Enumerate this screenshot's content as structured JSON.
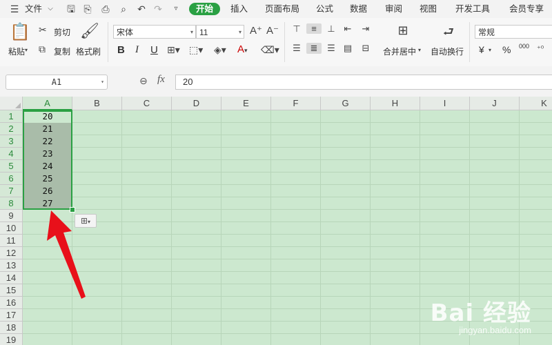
{
  "menubar": {
    "file": "文件",
    "tabs": [
      "开始",
      "插入",
      "页面布局",
      "公式",
      "数据",
      "审阅",
      "视图",
      "开发工具",
      "会员专享"
    ],
    "active_tab": "开始"
  },
  "ribbon": {
    "paste": "粘贴",
    "cut": "剪切",
    "copy": "复制",
    "format_painter": "格式刷",
    "font_name": "宋体",
    "font_size": "11",
    "bold": "B",
    "italic": "I",
    "underline": "U",
    "merge_center": "合并居中",
    "wrap_text": "自动换行",
    "number_format": "常规",
    "currency": "¥",
    "percent": "%",
    "thousands": "000"
  },
  "formula_bar": {
    "name_box": "A1",
    "fx": "fx",
    "value": "20"
  },
  "grid": {
    "columns": [
      "A",
      "B",
      "C",
      "D",
      "E",
      "F",
      "G",
      "H",
      "I",
      "J",
      "K"
    ],
    "rows": [
      "1",
      "2",
      "3",
      "4",
      "5",
      "6",
      "7",
      "8",
      "9",
      "10",
      "11",
      "12",
      "13",
      "14",
      "15",
      "16",
      "17",
      "18",
      "19"
    ],
    "column_a_values": [
      "20",
      "21",
      "22",
      "23",
      "24",
      "25",
      "26",
      "27"
    ]
  },
  "watermark": {
    "logo": "Bai 经验",
    "url": "jingyan.baidu.com"
  },
  "colors": {
    "accent": "#2aa043",
    "grid_bg": "#cce8cf",
    "arrow": "#e8101a"
  }
}
